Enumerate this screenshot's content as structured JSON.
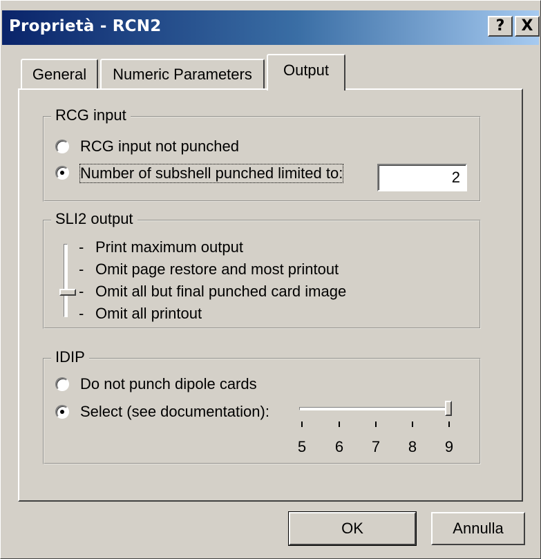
{
  "window": {
    "title": "Proprietà - RCN2",
    "help_btn": "?",
    "close_btn": "X"
  },
  "tabs": [
    {
      "label": "General"
    },
    {
      "label": "Numeric Parameters"
    },
    {
      "label": "Output",
      "selected": true
    }
  ],
  "rcg": {
    "label": "RCG input",
    "opt_not_punched": "RCG input not punched",
    "opt_limited": "Number of subshell punched limited to:",
    "selected": "limited",
    "value": "2"
  },
  "sli2": {
    "label": "SLI2 output",
    "levels": [
      "Print maximum output",
      "Omit page restore and most printout",
      "Omit all but final punched card image",
      "Omit all printout"
    ],
    "selected_index": 2
  },
  "idip": {
    "label": "IDIP",
    "opt_no_dipole": "Do not punch dipole cards",
    "opt_select": "Select (see documentation):",
    "selected": "select",
    "ticks": [
      "5",
      "6",
      "7",
      "8",
      "9"
    ],
    "value": 9
  },
  "buttons": {
    "ok": "OK",
    "cancel": "Annulla"
  }
}
